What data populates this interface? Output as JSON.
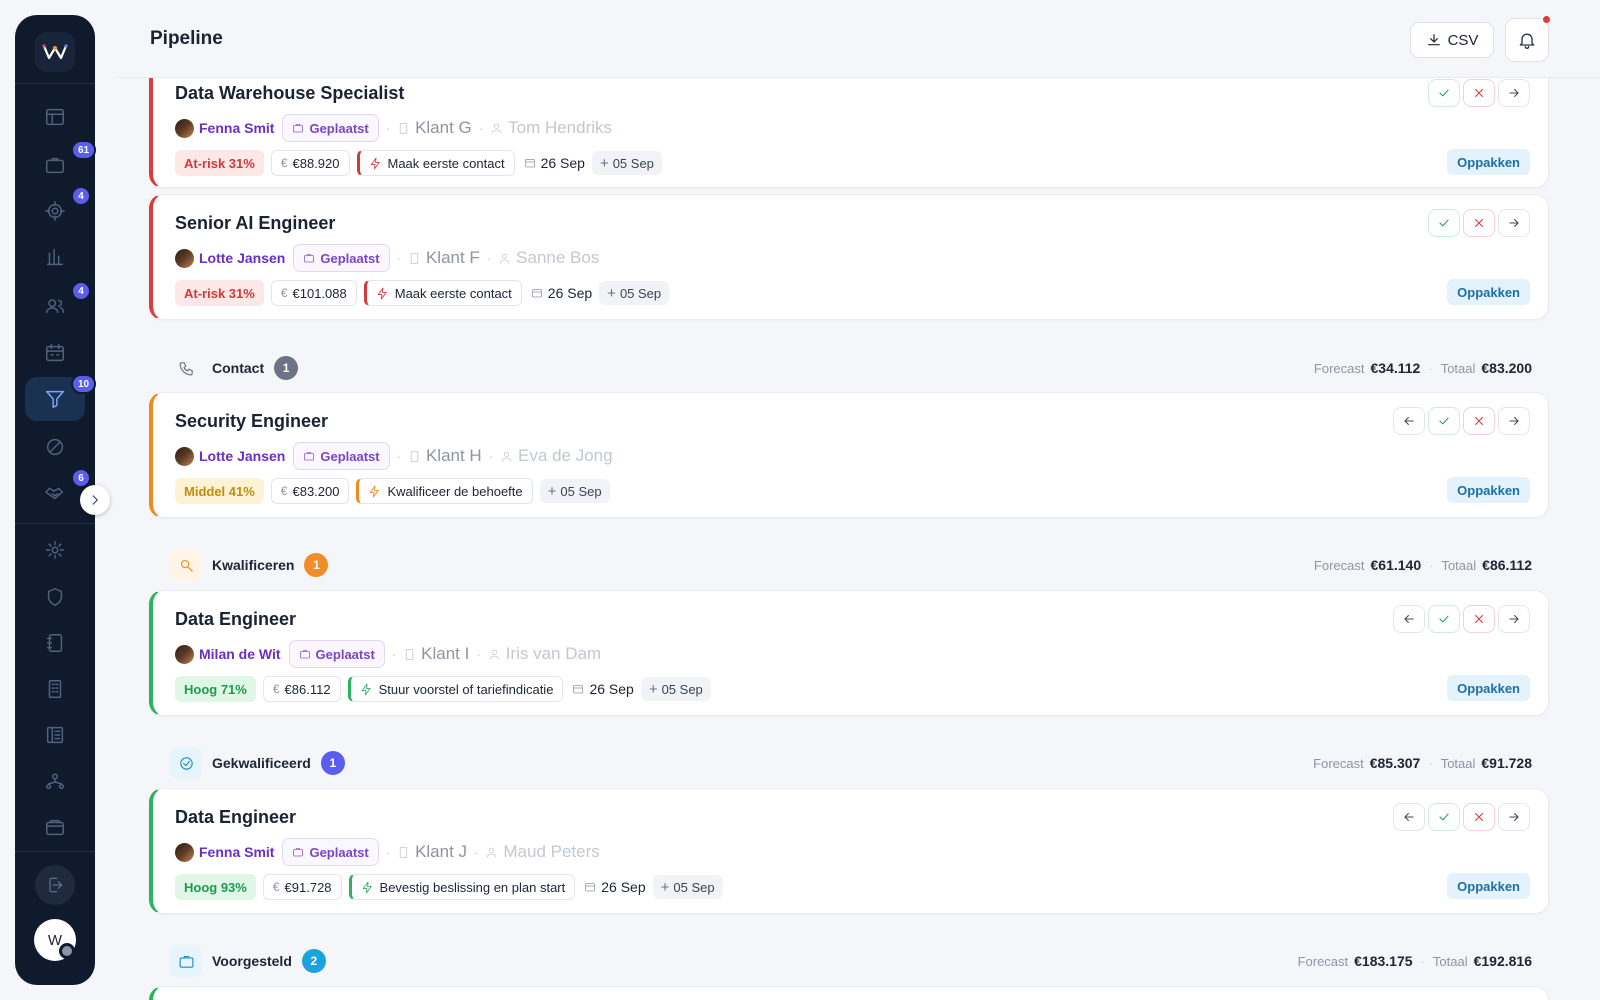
{
  "header": {
    "title": "Pipeline",
    "csv_label": "CSV"
  },
  "sidebar": {
    "logo_letter": "W",
    "nav": [
      {
        "name": "dashboard-icon",
        "badge": ""
      },
      {
        "name": "briefcase-icon",
        "badge": "61"
      },
      {
        "name": "target-icon",
        "badge": "4"
      },
      {
        "name": "bar-chart-icon",
        "badge": ""
      },
      {
        "name": "users-icon",
        "badge": "4"
      },
      {
        "name": "calendar-icon",
        "badge": ""
      },
      {
        "name": "funnel-icon",
        "badge": "10",
        "active": true
      },
      {
        "name": "block-icon",
        "badge": ""
      },
      {
        "name": "handshake-icon",
        "badge": "6"
      },
      {
        "name": "gear-icon",
        "badge": ""
      },
      {
        "name": "shield-icon",
        "badge": ""
      },
      {
        "name": "notebook-icon",
        "badge": ""
      },
      {
        "name": "building-icon",
        "badge": ""
      },
      {
        "name": "ledger-icon",
        "badge": ""
      },
      {
        "name": "org-chart-icon",
        "badge": ""
      },
      {
        "name": "wallet-icon",
        "badge": ""
      }
    ],
    "user_initial": "W"
  },
  "cards": [
    {
      "title": "Data Warehouse Specialist",
      "owner": "Fenna Smit",
      "status": "Geplaatst",
      "client": "Klant G",
      "contact": "Tom Hendriks",
      "score": "At-risk 31%",
      "value": "€88.920",
      "action": "Maak eerste contact",
      "date": "26 Sep",
      "followup": "05 Sep",
      "pickup": "Oppakken"
    },
    {
      "title": "Senior AI Engineer",
      "owner": "Lotte Jansen",
      "status": "Geplaatst",
      "client": "Klant F",
      "contact": "Sanne Bos",
      "score": "At-risk 31%",
      "value": "€101.088",
      "action": "Maak eerste contact",
      "date": "26 Sep",
      "followup": "05 Sep",
      "pickup": "Oppakken"
    },
    {
      "title": "Security Engineer",
      "owner": "Lotte Jansen",
      "status": "Geplaatst",
      "client": "Klant H",
      "contact": "Eva de Jong",
      "score": "Middel 41%",
      "value": "€83.200",
      "action": "Kwalificeer de behoefte",
      "date": "",
      "followup": "05 Sep",
      "pickup": "Oppakken"
    },
    {
      "title": "Data Engineer",
      "owner": "Milan de Wit",
      "status": "Geplaatst",
      "client": "Klant I",
      "contact": "Iris van Dam",
      "score": "Hoog 71%",
      "value": "€86.112",
      "action": "Stuur voorstel of tariefindicatie",
      "date": "26 Sep",
      "followup": "05 Sep",
      "pickup": "Oppakken"
    },
    {
      "title": "Data Engineer",
      "owner": "Fenna Smit",
      "status": "Geplaatst",
      "client": "Klant J",
      "contact": "Maud Peters",
      "score": "Hoog 93%",
      "value": "€91.728",
      "action": "Bevestig beslissing en plan start",
      "date": "26 Sep",
      "followup": "05 Sep",
      "pickup": "Oppakken"
    }
  ],
  "sections": [
    {
      "label": "Contact",
      "count": "1",
      "forecast_label": "Forecast",
      "forecast": "€34.112",
      "total_label": "Totaal",
      "total": "€83.200",
      "color": "#6b7385"
    },
    {
      "label": "Kwalificeren",
      "count": "1",
      "forecast_label": "Forecast",
      "forecast": "€61.140",
      "total_label": "Totaal",
      "total": "€86.112",
      "color": "#f28c28"
    },
    {
      "label": "Gekwalificeerd",
      "count": "1",
      "forecast_label": "Forecast",
      "forecast": "€85.307",
      "total_label": "Totaal",
      "total": "€91.728",
      "color": "#5b5cf0"
    },
    {
      "label": "Voorgesteld",
      "count": "2",
      "forecast_label": "Forecast",
      "forecast": "€183.175",
      "total_label": "Totaal",
      "total": "€192.816",
      "color": "#1ba3dd"
    }
  ]
}
